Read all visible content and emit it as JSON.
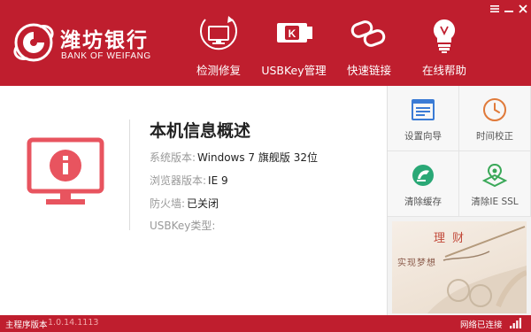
{
  "brand": {
    "name_cn": "潍坊银行",
    "name_en": "BANK OF WEIFANG",
    "logo_icon": "bank-logo-icon"
  },
  "window_controls": {
    "menu_icon": "menu-icon",
    "minimize_icon": "minimize-icon",
    "close_icon": "close-icon"
  },
  "nav": [
    {
      "label": "检测修复",
      "icon": "monitor-refresh-icon"
    },
    {
      "label": "USBKey管理",
      "icon": "usb-key-icon"
    },
    {
      "label": "快速链接",
      "icon": "link-icon"
    },
    {
      "label": "在线帮助",
      "icon": "lightbulb-icon"
    }
  ],
  "overview": {
    "title": "本机信息概述",
    "icon": "monitor-info-icon",
    "rows": [
      {
        "label": "系统版本:",
        "value": "Windows 7  旗舰版    32位"
      },
      {
        "label": "浏览器版本:",
        "value": "IE 9"
      },
      {
        "label": "防火墙:",
        "value": "已关闭"
      },
      {
        "label": "USBKey类型:",
        "value": ""
      }
    ]
  },
  "tools": [
    {
      "label": "设置向导",
      "icon": "settings-wizard-icon",
      "color": "#3a7bd5"
    },
    {
      "label": "时间校正",
      "icon": "clock-icon",
      "color": "#e07a3a"
    },
    {
      "label": "清除缓存",
      "icon": "clear-cache-icon",
      "color": "#2aa876"
    },
    {
      "label": "清除IE SSL",
      "icon": "clear-ssl-icon",
      "color": "#3aa858"
    }
  ],
  "promo": {
    "line1": "理 财",
    "line2": "实现梦想"
  },
  "status": {
    "version_label": "主程序版本",
    "version_value": "1.0.14.1113",
    "network_label": "网络已连接",
    "signal_icon": "signal-icon"
  },
  "colors": {
    "brand_red": "#bf1e2e",
    "icon_pink": "#e8545f"
  }
}
